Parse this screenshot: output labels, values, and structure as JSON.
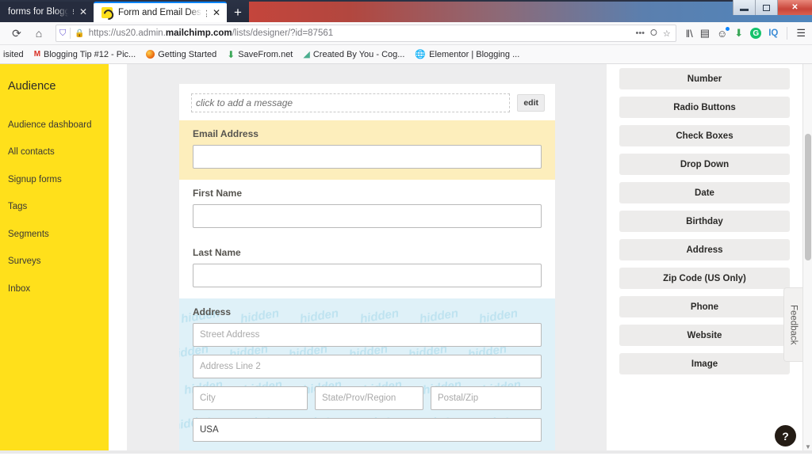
{
  "window": {
    "controls": {
      "minimize": "minimize-button",
      "maximize": "maximize-button",
      "close": "✕"
    }
  },
  "tabs": [
    {
      "title": "forms for Blogger VJ | M",
      "active": false,
      "close": "✕"
    },
    {
      "title": "Form and Email Designer | Mail",
      "active": true,
      "close": "✕"
    }
  ],
  "newtab_label": "+",
  "navbar": {
    "reload_icon": "⟳",
    "home_icon": "⌂",
    "shield_icon": "⛉",
    "lock_icon": "🔒",
    "url_prefix": "https://us20.admin.",
    "url_domain": "mailchimp.com",
    "url_suffix": "/lists/designer/?id=87561",
    "page_actions": "•••",
    "pocket_icon": "⭘",
    "bookmark_star": "☆",
    "toolbar_icons": [
      {
        "name": "library-icon",
        "glyph": "‖\\"
      },
      {
        "name": "sidebar-icon",
        "glyph": "▤"
      },
      {
        "name": "account-icon",
        "glyph": "●"
      },
      {
        "name": "downloads-icon",
        "glyph": "⬇"
      },
      {
        "name": "grammarly-icon",
        "glyph": "G"
      },
      {
        "name": "iq-extension-icon",
        "glyph": "IQ"
      },
      {
        "name": "menu-icon",
        "glyph": "☰"
      }
    ]
  },
  "bookmarks": [
    {
      "label": "isited",
      "icon": "none"
    },
    {
      "label": "Blogging Tip #12 - Pic...",
      "icon": "gmail-icon"
    },
    {
      "label": "Getting Started",
      "icon": "firefox-icon"
    },
    {
      "label": "SaveFrom.net",
      "icon": "download-icon"
    },
    {
      "label": "Created By You - Cog...",
      "icon": "cognito-icon"
    },
    {
      "label": "Elementor | Blogging ...",
      "icon": "globe-icon"
    }
  ],
  "sidebar": {
    "header": "Audience",
    "items": [
      {
        "label": "Audience dashboard"
      },
      {
        "label": "All contacts"
      },
      {
        "label": "Signup forms"
      },
      {
        "label": "Tags"
      },
      {
        "label": "Segments"
      },
      {
        "label": "Surveys"
      },
      {
        "label": "Inbox"
      }
    ]
  },
  "form": {
    "message": {
      "placeholder": "click to add a message",
      "edit_label": "edit"
    },
    "fields": [
      {
        "label": "Email Address",
        "value": "",
        "placeholder": "",
        "highlight": true
      },
      {
        "label": "First Name",
        "value": "",
        "placeholder": "",
        "highlight": false
      },
      {
        "label": "Last Name",
        "value": "",
        "placeholder": "",
        "highlight": false
      }
    ],
    "address": {
      "label": "Address",
      "watermark": "hidden",
      "street": "Street Address",
      "line2": "Address Line 2",
      "city": "City",
      "state": "State/Prov/Region",
      "zip": "Postal/Zip",
      "country_value": "USA"
    }
  },
  "palette": {
    "buttons": [
      "Number",
      "Radio Buttons",
      "Check Boxes",
      "Drop Down",
      "Date",
      "Birthday",
      "Address",
      "Zip Code (US Only)",
      "Phone",
      "Website",
      "Image"
    ]
  },
  "feedback_label": "Feedback",
  "help_label": "?",
  "colors": {
    "brand_yellow": "#ffe01b",
    "highlight_cream": "#fdeebc",
    "hidden_blue": "#dff1f8",
    "canvas_grey": "#ededee",
    "palette_button": "#edeceb"
  }
}
